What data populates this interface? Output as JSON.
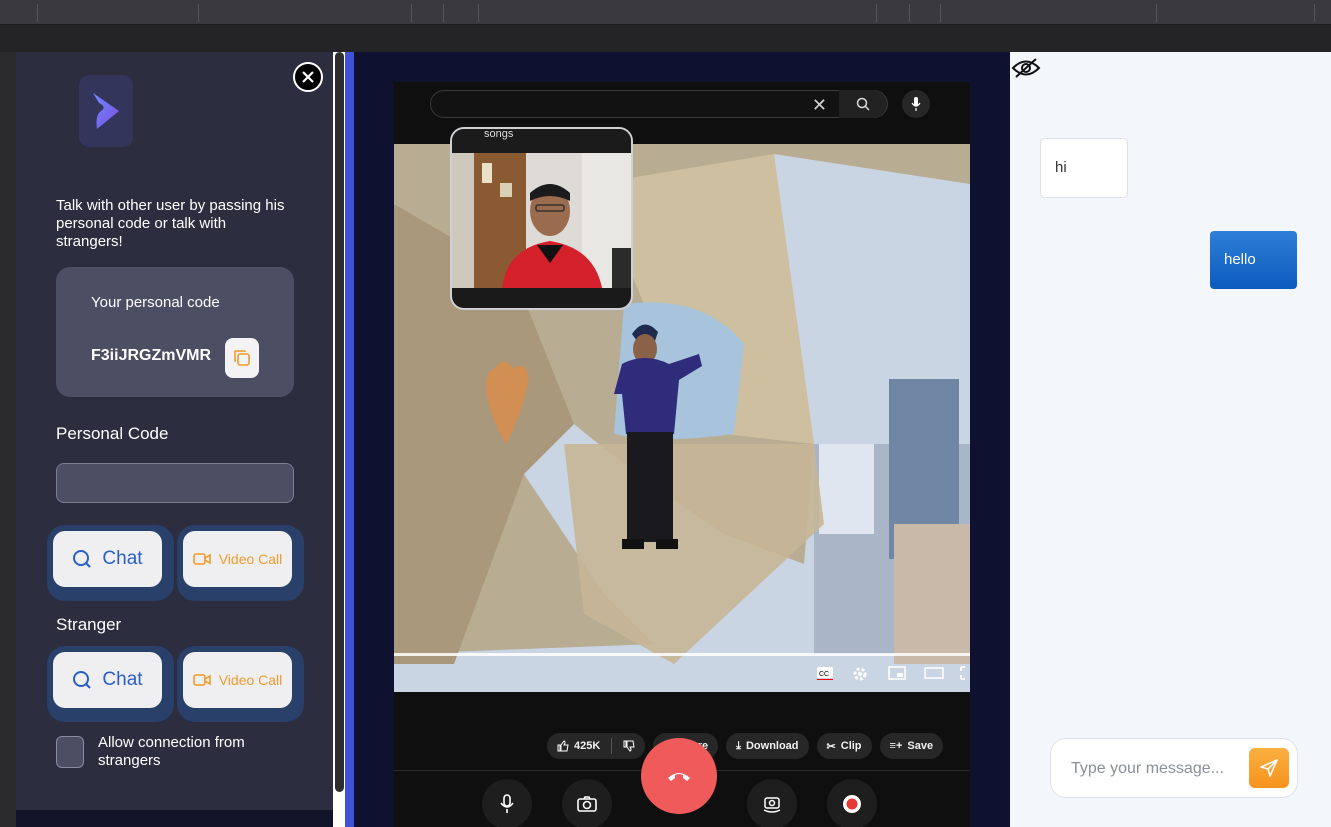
{
  "sidebar": {
    "intro": "Talk with other user by passing his personal code or talk with strangers!",
    "personal_code_card": {
      "label": "Your personal code",
      "code": "F3iiJRGZmVMR"
    },
    "personal_code_section": "Personal Code",
    "personal_code_input_value": "",
    "chat_label": "Chat",
    "video_call_label": "Video Call",
    "stranger_section": "Stranger",
    "allow_strangers_label": "Allow connection from strangers"
  },
  "video": {
    "search_query": "songs",
    "pip_search_text": "songs",
    "likes": "425K",
    "share_label": "Share",
    "download_label": "Download",
    "clip_label": "Clip",
    "save_label": "Save"
  },
  "chat": {
    "messages": [
      {
        "direction": "incoming",
        "text": "hi"
      },
      {
        "direction": "outgoing",
        "text": "hello"
      }
    ],
    "input_placeholder": "Type your message..."
  },
  "colors": {
    "sidebar_bg": "#2c2d3f",
    "accent_blue": "#2a5fc4",
    "accent_orange": "#f39b2a",
    "hangup_red": "#f05a5a",
    "chat_bubble_out": "#0b5bbf"
  },
  "icons": [
    "logo-icon",
    "close-icon",
    "copy-icon",
    "chat-icon",
    "video-camera-icon",
    "eye-off-icon",
    "send-icon",
    "mic-icon",
    "camera-icon",
    "phone-hangup-icon",
    "switch-camera-icon",
    "record-icon",
    "search-icon"
  ]
}
